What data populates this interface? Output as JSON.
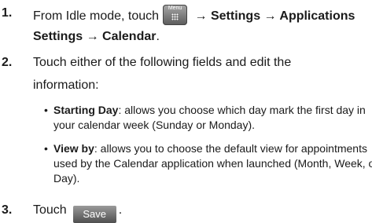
{
  "steps": [
    {
      "number": "1.",
      "line1": {
        "before_icon": "From Idle mode, touch",
        "icon_label": "Menu",
        "after_icon": " → Settings → Applications"
      },
      "line2": "Settings → Calendar",
      "line2_end": "."
    },
    {
      "number": "2.",
      "line1": "Touch either of the following fields and edit the",
      "line2": "information:",
      "bullets": [
        {
          "term": "Starting Day",
          "lines": [
            ": allows you choose which day mark the first day in",
            "your calendar week (Sunday or Monday)."
          ]
        },
        {
          "term": "View by",
          "lines": [
            ": allows you to choose the default view for appointments",
            "used by the Calendar application when launched (Month, Week, or",
            "Day)."
          ]
        }
      ]
    },
    {
      "number": "3.",
      "before_button": "Touch",
      "button_label": "Save",
      "after_button": "."
    }
  ]
}
